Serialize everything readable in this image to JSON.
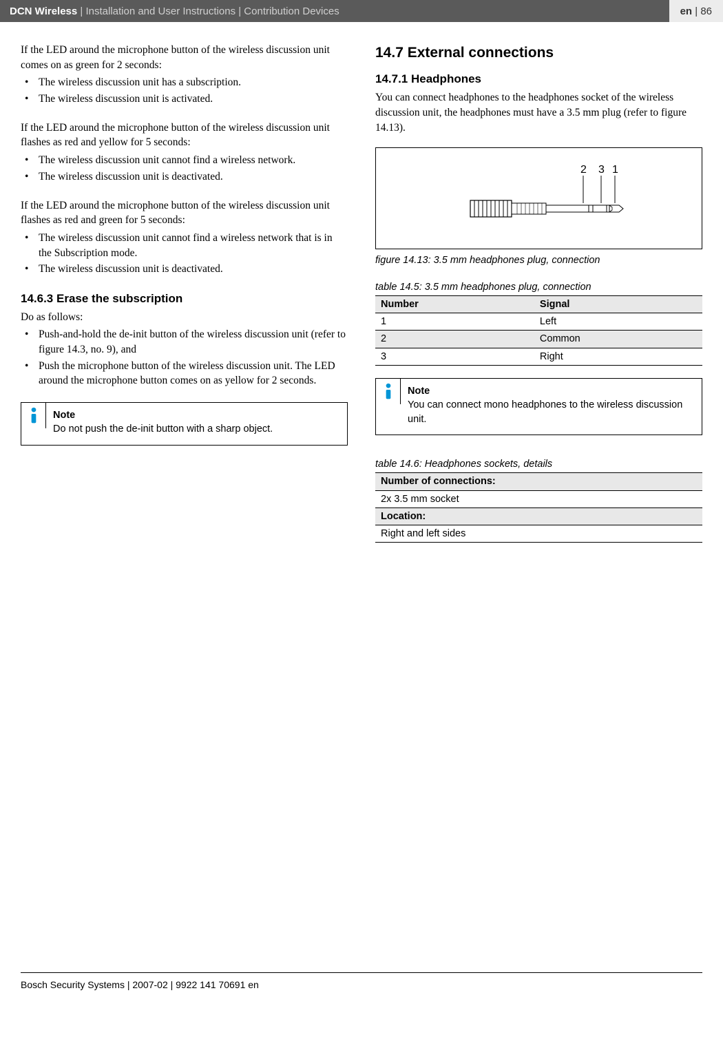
{
  "header": {
    "title": "DCN Wireless",
    "subtitle": " | Installation and User Instructions | Contribution Devices",
    "lang": "en",
    "page": "86"
  },
  "left": {
    "p1": "If the LED around the microphone button of the wireless discussion unit comes on as green for 2 seconds:",
    "list1": [
      "The wireless discussion unit has a subscription.",
      "The wireless discussion unit is activated."
    ],
    "p2": "If the LED around the microphone button of the wireless discussion unit flashes as red and yellow for 5 seconds:",
    "list2": [
      "The wireless discussion unit cannot find a wireless network.",
      "The wireless discussion unit is deactivated."
    ],
    "p3": "If the LED around the microphone button of the wireless discussion unit flashes as red and green for 5 seconds:",
    "list3": [
      "The wireless discussion unit cannot find a wireless network that is in the Subscription mode.",
      "The wireless discussion unit is deactivated."
    ],
    "h_erase": "14.6.3   Erase the subscription",
    "p4": "Do as follows:",
    "list4": [
      "Push-and-hold the de-init button of the wireless discussion unit (refer to figure 14.3, no. 9), and",
      "Push the microphone button of the wireless discussion unit. The LED around the microphone button comes on as yellow for 2 seconds."
    ],
    "note1_title": "Note",
    "note1_body": "Do not push the de-init button with a sharp object."
  },
  "right": {
    "h_ext": "14.7    External connections",
    "h_hp": "14.7.1   Headphones",
    "p_hp": "You can connect headphones to the headphones socket of the wireless discussion unit, the headphones must have a 3.5 mm plug (refer to figure 14.13).",
    "fig_labels": {
      "a": "2",
      "b": "3",
      "c": "1"
    },
    "fig_caption": "figure 14.13: 3.5 mm headphones plug, connection",
    "table5_caption": "table 14.5: 3.5 mm headphones plug, connection",
    "table5_headers": {
      "number": "Number",
      "signal": "Signal"
    },
    "table5_rows": [
      {
        "number": "1",
        "signal": "Left"
      },
      {
        "number": "2",
        "signal": "Common"
      },
      {
        "number": "3",
        "signal": "Right"
      }
    ],
    "note2_title": "Note",
    "note2_body": "You can connect mono headphones to the wireless discussion unit.",
    "table6_caption": "table 14.6: Headphones sockets, details",
    "table6_rows": [
      {
        "label": "Number of connections:",
        "shaded": true
      },
      {
        "label": "2x 3.5 mm socket",
        "shaded": false
      },
      {
        "label": "Location:",
        "shaded": true
      },
      {
        "label": "Right and left sides",
        "shaded": false
      }
    ]
  },
  "footer": "Bosch Security Systems | 2007-02 | 9922 141 70691 en"
}
